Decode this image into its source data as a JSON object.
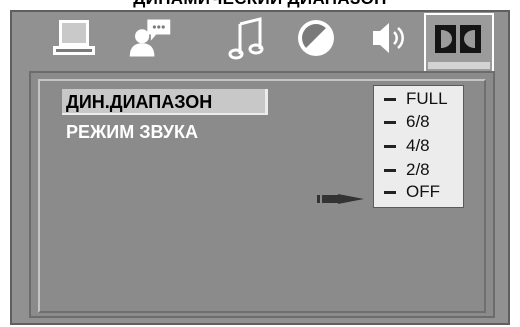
{
  "header": {
    "title": "ДИНАМИЧЕСКИЙ ДИАПАЗОН"
  },
  "tabs": [
    {
      "icon": "monitor-icon"
    },
    {
      "icon": "user-chat-icon"
    },
    {
      "icon": "music-note-icon"
    },
    {
      "icon": "contrast-icon"
    },
    {
      "icon": "speaker-icon"
    },
    {
      "icon": "dolby-icon",
      "active": true
    }
  ],
  "menu": {
    "items": [
      {
        "label": "ДИН.ДИАПАЗОН",
        "selected": true
      },
      {
        "label": "РЕЖИМ ЗВУКА",
        "selected": false
      }
    ]
  },
  "levels": {
    "options": [
      "FULL",
      "6/8",
      "4/8",
      "2/8",
      "OFF"
    ],
    "current": "OFF"
  },
  "colors": {
    "frame": "#919191",
    "panel": "#8b8b8b",
    "highlight": "#c8c8c8",
    "levels_bg": "#ececec"
  }
}
